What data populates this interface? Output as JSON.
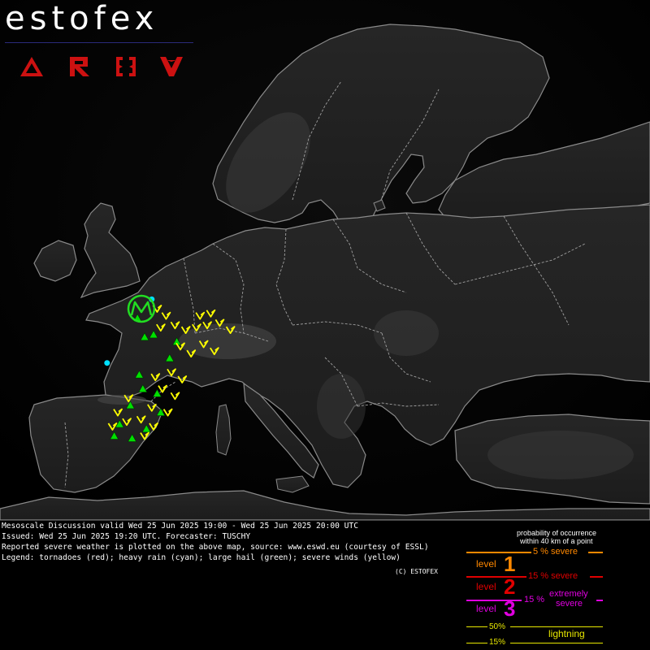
{
  "brand": {
    "name": "estofex"
  },
  "nav": [
    {
      "id": "nav-forecasts",
      "glyph": "triangle"
    },
    {
      "id": "nav-reports",
      "glyph": "r-arrow"
    },
    {
      "id": "nav-mesoscale",
      "glyph": "brackets"
    },
    {
      "id": "nav-verification",
      "glyph": "v-chevron"
    }
  ],
  "colors": {
    "level1": "#ff8800",
    "level2": "#e00000",
    "level3": "#e000e0",
    "lightning": "#e8e800",
    "tornado": "#ff0000",
    "rain": "#00e0ff",
    "hail": "#00e000",
    "wind": "#ffff00",
    "nav": "#cc1111"
  },
  "map": {
    "region": "Europe",
    "reports": [
      {
        "type": "heavy-rain",
        "lon": -1.6,
        "lat": 46.7
      },
      {
        "type": "heavy-rain",
        "lon": 0.9,
        "lat": 49.4
      },
      {
        "type": "large-hail",
        "lon": 0.1,
        "lat": 48.6
      },
      {
        "type": "large-hail",
        "lon": 0.5,
        "lat": 47.8
      },
      {
        "type": "large-hail",
        "lon": 1.0,
        "lat": 47.9
      },
      {
        "type": "large-hail",
        "lon": 0.2,
        "lat": 46.2
      },
      {
        "type": "large-hail",
        "lon": 0.4,
        "lat": 45.6
      },
      {
        "type": "large-hail",
        "lon": 1.2,
        "lat": 45.4
      },
      {
        "type": "large-hail",
        "lon": -0.3,
        "lat": 44.9
      },
      {
        "type": "large-hail",
        "lon": 1.4,
        "lat": 44.6
      },
      {
        "type": "large-hail",
        "lon": -0.9,
        "lat": 44.1
      },
      {
        "type": "large-hail",
        "lon": -1.2,
        "lat": 43.6
      },
      {
        "type": "large-hail",
        "lon": -0.2,
        "lat": 43.5
      },
      {
        "type": "large-hail",
        "lon": 0.6,
        "lat": 43.9
      },
      {
        "type": "large-hail",
        "lon": 1.9,
        "lat": 46.9
      },
      {
        "type": "large-hail",
        "lon": 2.3,
        "lat": 47.6
      },
      {
        "type": "severe-wind",
        "lon": 1.2,
        "lat": 49.0
      },
      {
        "type": "severe-wind",
        "lon": 1.7,
        "lat": 48.7
      },
      {
        "type": "severe-wind",
        "lon": 2.2,
        "lat": 48.3
      },
      {
        "type": "severe-wind",
        "lon": 2.8,
        "lat": 48.1
      },
      {
        "type": "severe-wind",
        "lon": 3.4,
        "lat": 48.2
      },
      {
        "type": "severe-wind",
        "lon": 4.0,
        "lat": 48.3
      },
      {
        "type": "severe-wind",
        "lon": 4.7,
        "lat": 48.4
      },
      {
        "type": "severe-wind",
        "lon": 5.3,
        "lat": 48.1
      },
      {
        "type": "severe-wind",
        "lon": 2.5,
        "lat": 47.4
      },
      {
        "type": "severe-wind",
        "lon": 3.1,
        "lat": 47.1
      },
      {
        "type": "severe-wind",
        "lon": 3.8,
        "lat": 47.5
      },
      {
        "type": "severe-wind",
        "lon": 4.4,
        "lat": 47.2
      },
      {
        "type": "severe-wind",
        "lon": 2.0,
        "lat": 46.3
      },
      {
        "type": "severe-wind",
        "lon": 2.6,
        "lat": 46.0
      },
      {
        "type": "severe-wind",
        "lon": 1.5,
        "lat": 45.6
      },
      {
        "type": "severe-wind",
        "lon": 2.2,
        "lat": 45.3
      },
      {
        "type": "severe-wind",
        "lon": 0.9,
        "lat": 44.8
      },
      {
        "type": "severe-wind",
        "lon": 1.8,
        "lat": 44.6
      },
      {
        "type": "severe-wind",
        "lon": 0.3,
        "lat": 44.3
      },
      {
        "type": "severe-wind",
        "lon": 1.0,
        "lat": 44.0
      },
      {
        "type": "severe-wind",
        "lon": -1.0,
        "lat": 44.6
      },
      {
        "type": "severe-wind",
        "lon": -0.5,
        "lat": 44.2
      },
      {
        "type": "severe-wind",
        "lon": -1.3,
        "lat": 44.0
      },
      {
        "type": "severe-wind",
        "lon": 0.5,
        "lat": 43.6
      },
      {
        "type": "severe-wind",
        "lon": -0.4,
        "lat": 45.2
      },
      {
        "type": "severe-wind",
        "lon": 1.1,
        "lat": 46.1
      },
      {
        "type": "severe-wind",
        "lon": 3.6,
        "lat": 48.7
      },
      {
        "type": "severe-wind",
        "lon": 4.2,
        "lat": 48.8
      },
      {
        "type": "severe-wind",
        "lon": 1.4,
        "lat": 48.2
      }
    ]
  },
  "footer": {
    "line1": "Mesoscale Discussion valid Wed 25 Jun 2025 19:00 - Wed 25 Jun 2025 20:00 UTC",
    "line2": "Issued: Wed 25 Jun 2025 19:20 UTC. Forecaster: TUSCHY",
    "line3": "Reported severe weather is plotted on the above map, source: www.eswd.eu (courtesy of ESSL)",
    "line4": "Legend: tornadoes (red); heavy rain (cyan); large hail (green); severe winds (yellow)",
    "copyright": "(C) ESTOFEX"
  },
  "legend": {
    "header1": "probability of occurrence",
    "header2": "within 40 km of a point",
    "level_word": "level",
    "l1_num": "1",
    "l1_pct": "5 % severe",
    "l2_num": "2",
    "l2_pct": "15 % severe",
    "l3_num": "3",
    "l3_pct": "15 %",
    "l3_extreme1": "extremely",
    "l3_extreme2": "severe",
    "lt_50": "50%",
    "lt_15": "15%",
    "lt_label": "lightning"
  }
}
